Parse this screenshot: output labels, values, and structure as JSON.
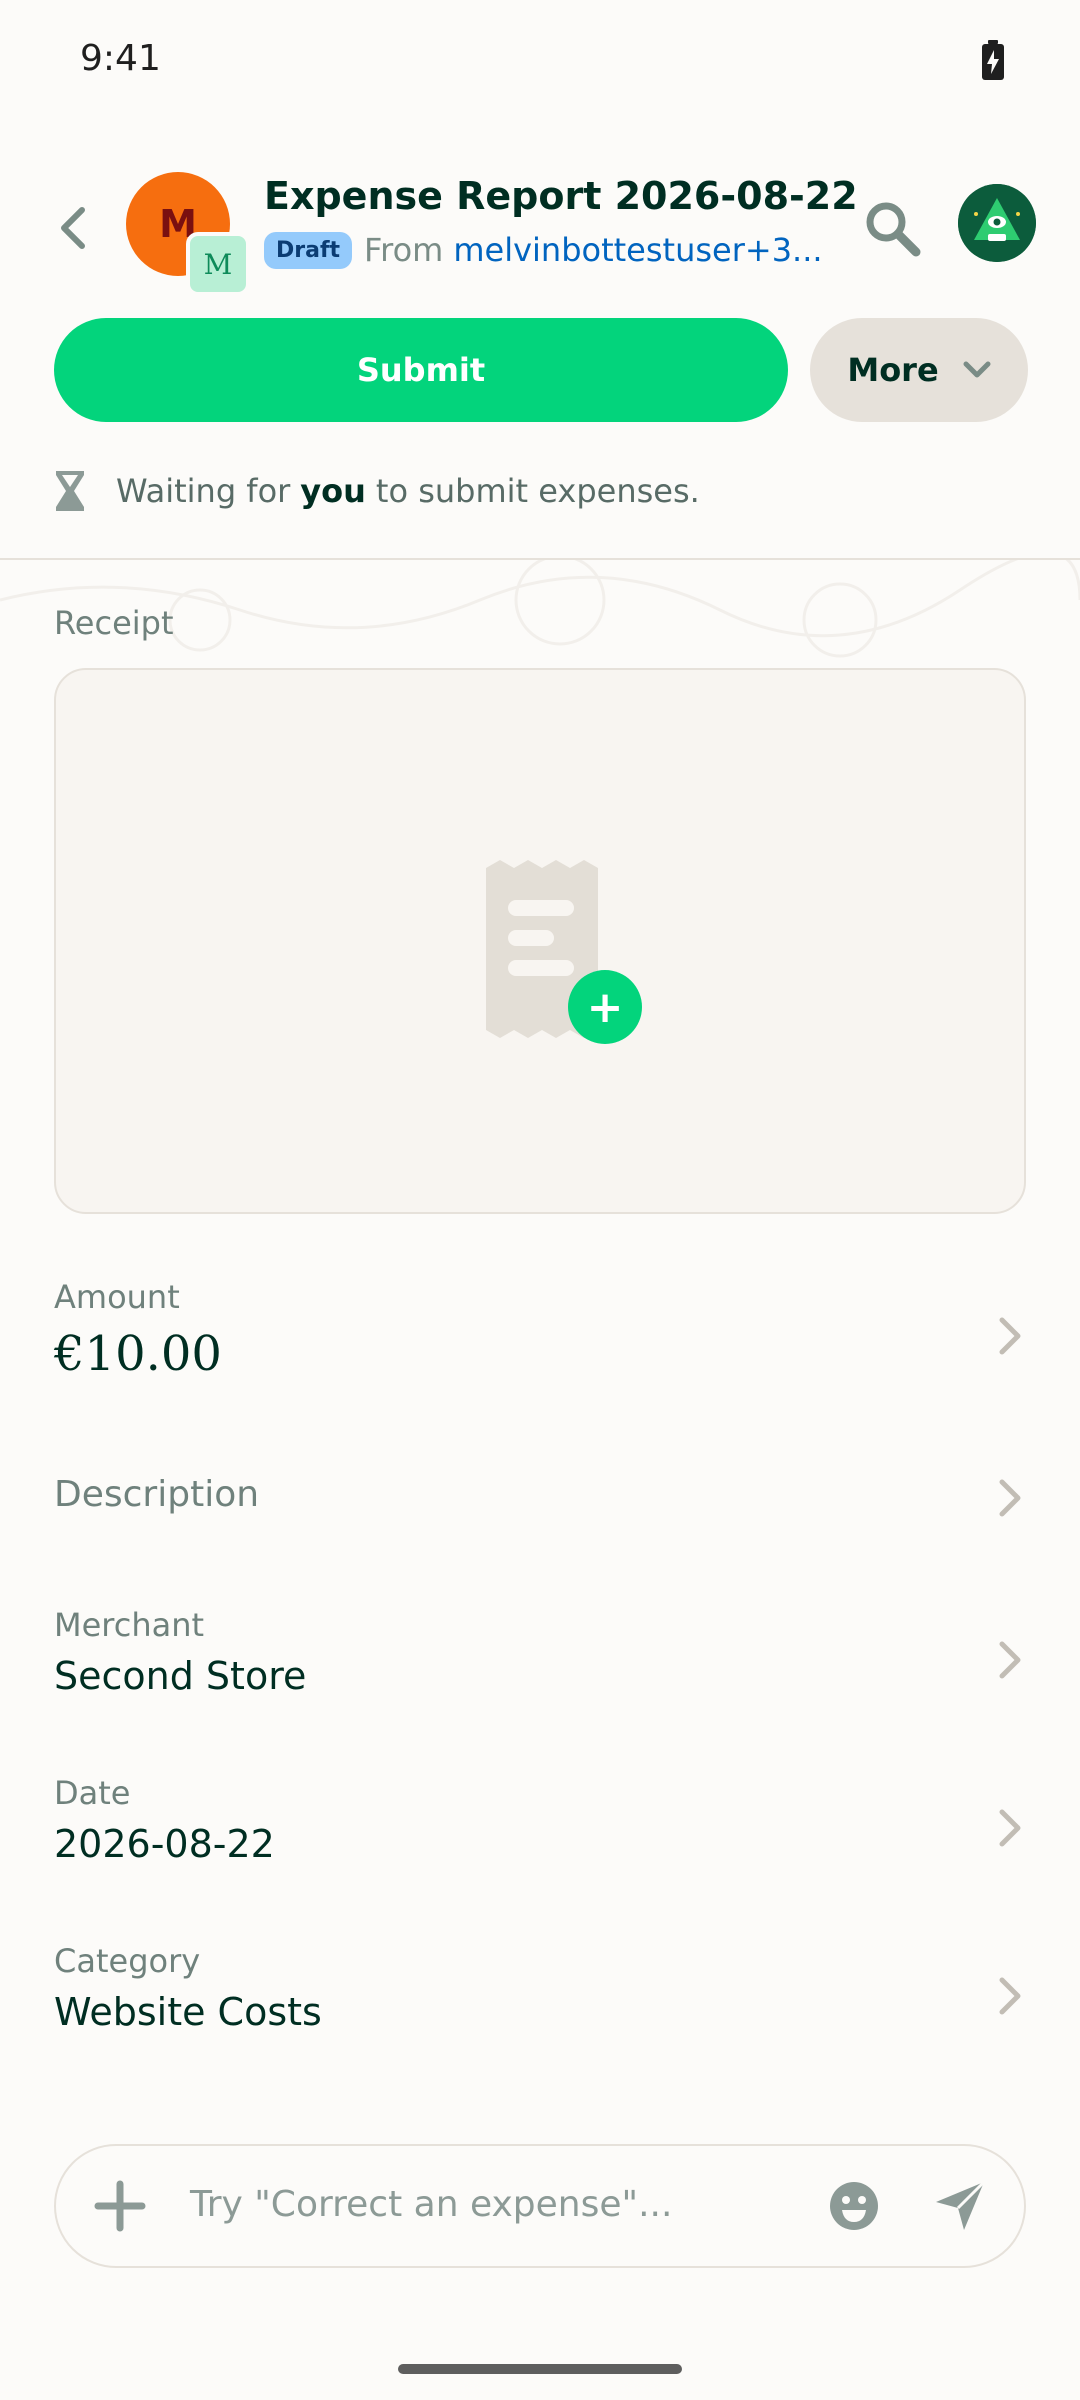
{
  "status_bar": {
    "time": "9:41"
  },
  "header": {
    "avatar_initial": "M",
    "workspace_initial": "M",
    "title": "Expense Report 2026-08-22",
    "badge": "Draft",
    "from_label": "From",
    "from_user": "melvinbottestuser+3..."
  },
  "actions": {
    "submit_label": "Submit",
    "more_label": "More"
  },
  "waiting": {
    "prefix": "Waiting for",
    "bold": "you",
    "suffix": "to submit expenses."
  },
  "receipt": {
    "label": "Receipt"
  },
  "fields": {
    "amount": {
      "label": "Amount",
      "value": "€10.00"
    },
    "description": {
      "label": "Description"
    },
    "merchant": {
      "label": "Merchant",
      "value": "Second Store"
    },
    "date": {
      "label": "Date",
      "value": "2026-08-22"
    },
    "category": {
      "label": "Category",
      "value": "Website Costs"
    }
  },
  "composer": {
    "placeholder": "Try \"Correct an expense\"..."
  },
  "colors": {
    "accent": "#03D47C",
    "text": "#002E22",
    "link": "#0164BF",
    "avatar": "#F66E0F"
  }
}
